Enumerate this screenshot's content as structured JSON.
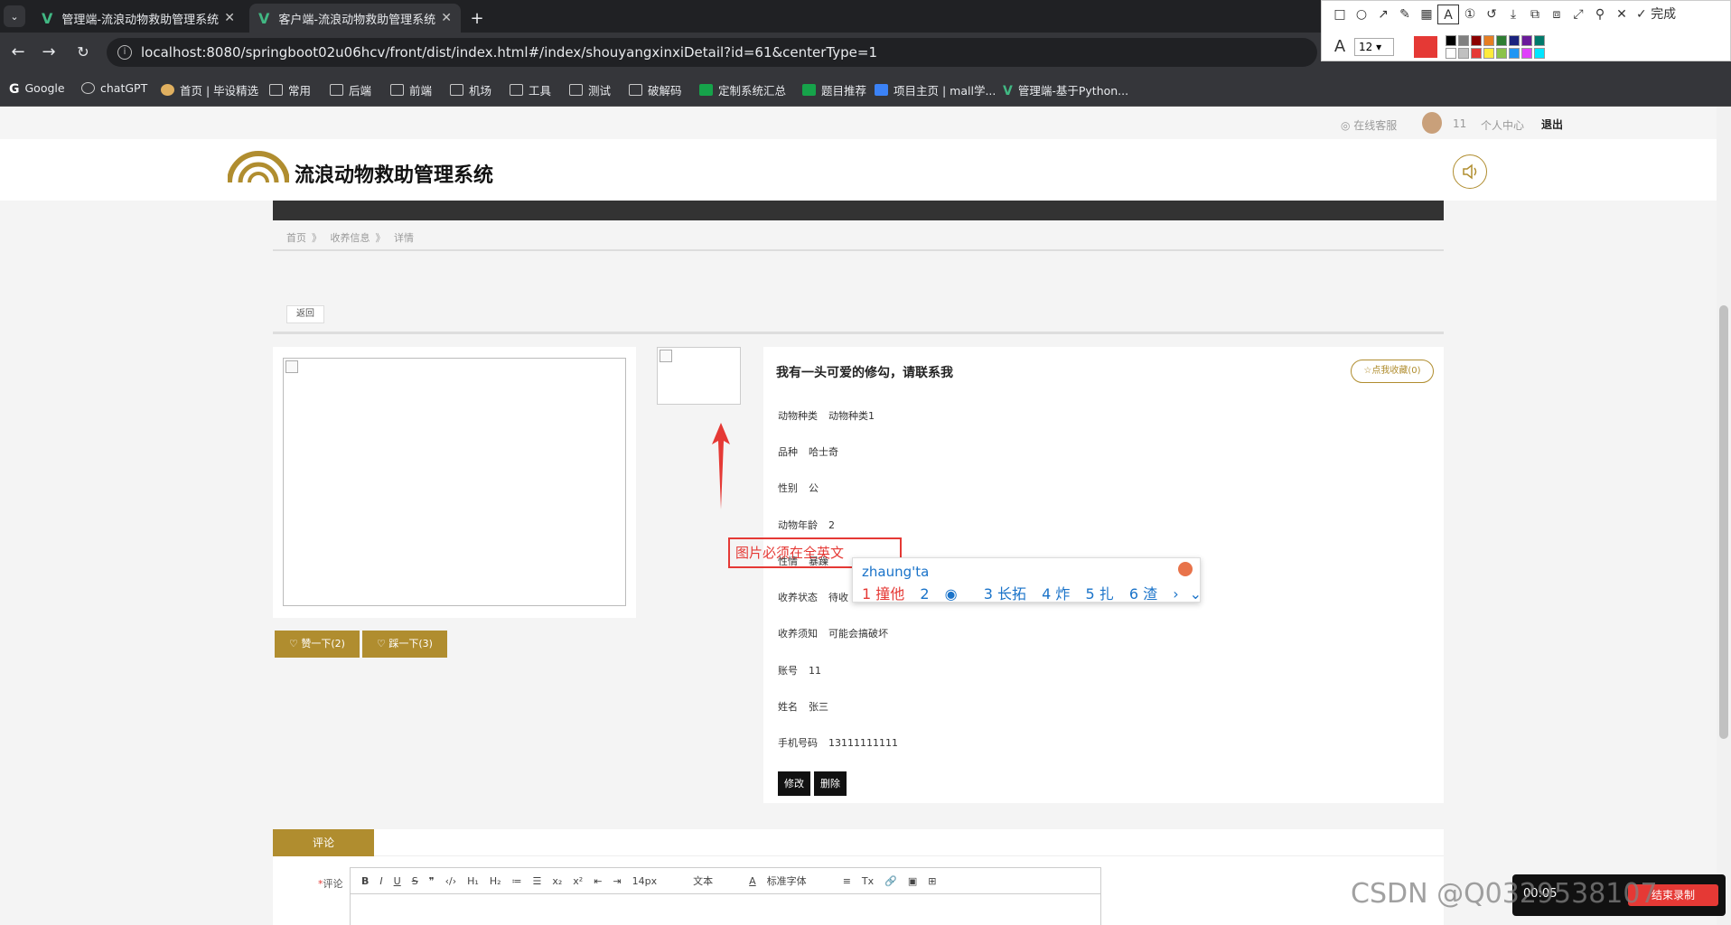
{
  "browser": {
    "tabs": [
      {
        "title": "管理端-流浪动物救助管理系统",
        "active": false
      },
      {
        "title": "客户端-流浪动物救助管理系统",
        "active": true
      }
    ],
    "url": "localhost:8080/springboot02u06hcv/front/dist/index.html#/index/shouyangxinxiDetail?id=61&centerType=1",
    "bookmarks": [
      "Google",
      "chatGPT",
      "首页 | 毕设精选",
      "常用",
      "后端",
      "前端",
      "机场",
      "工具",
      "测试",
      "破解码",
      "定制系统汇总",
      "题目推荐",
      "项目主页 | mall学...",
      "管理端-基于Python..."
    ]
  },
  "annotation_toolbar": {
    "font_size": "12",
    "done_label": "完成",
    "accent_color": "#e53935"
  },
  "site": {
    "topbar": {
      "service": "在线客服",
      "user": "11",
      "center": "个人中心",
      "logout": "退出"
    },
    "title": "流浪动物救助管理系统",
    "breadcrumb": [
      "首页",
      "收养信息",
      "详情"
    ],
    "back_label": "返回",
    "like_label": "赞一下(2)",
    "dislike_label": "踩一下(3)",
    "detail": {
      "title": "我有一头可爱的修勾，请联系我",
      "fav_label": "☆点我收藏(0)",
      "fields": [
        {
          "label": "动物种类",
          "value": "动物种类1"
        },
        {
          "label": "品种",
          "value": "哈士奇"
        },
        {
          "label": "性别",
          "value": "公"
        },
        {
          "label": "动物年龄",
          "value": "2"
        },
        {
          "label": "性情",
          "value": "暴躁"
        },
        {
          "label": "收养状态",
          "value": "待收"
        },
        {
          "label": "收养须知",
          "value": "可能会搞破坏"
        },
        {
          "label": "账号",
          "value": "11"
        },
        {
          "label": "姓名",
          "value": "张三"
        },
        {
          "label": "手机号码",
          "value": "13111111111"
        }
      ],
      "edit_label": "修改",
      "delete_label": "删除"
    },
    "annotation_note": "图片必须在全英文",
    "ime": {
      "input": "zhaung'ta",
      "candidates": [
        "1 撞他",
        "2",
        "3 长拓",
        "4 炸",
        "5 扎",
        "6 渣"
      ]
    },
    "comment": {
      "tab_label": "评论",
      "field_label": "评论",
      "toolbar": [
        "B",
        "I",
        "U",
        "S",
        "❞",
        "‹/›",
        "H₁",
        "H₂",
        "≔",
        "☰",
        "x₂",
        "x²",
        "⇤",
        "⇥",
        "14px",
        "文本",
        "A",
        "标准字体",
        "≡",
        "Tx",
        "🔗",
        "▣",
        "⊞"
      ]
    }
  },
  "watermark": "CSDN @Q0329538107",
  "recording": {
    "time": "00:05",
    "stop_label": "结束录制"
  }
}
